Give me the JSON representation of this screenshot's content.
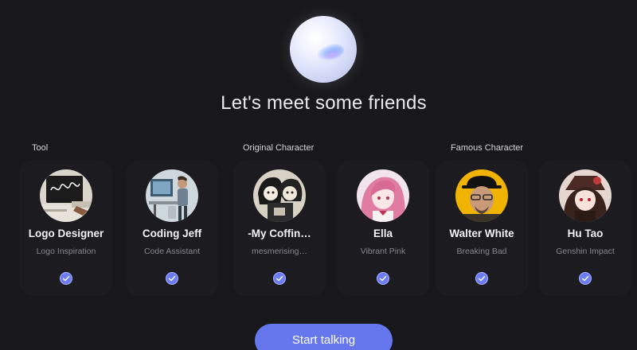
{
  "title": "Let's meet some friends",
  "groups": [
    {
      "label": "Tool"
    },
    {
      "label": "Original Character"
    },
    {
      "label": "Famous Character"
    }
  ],
  "characters": [
    {
      "name": "Logo Designer",
      "subtitle": "Logo Inspiration",
      "selected": true
    },
    {
      "name": "Coding Jeff",
      "subtitle": "Code Assistant",
      "selected": true
    },
    {
      "name": "-My Coffin…",
      "subtitle": "mesmerising…",
      "selected": true
    },
    {
      "name": "Ella",
      "subtitle": "Vibrant Pink",
      "selected": true
    },
    {
      "name": "Walter White",
      "subtitle": "Breaking Bad",
      "selected": true
    },
    {
      "name": "Hu Tao",
      "subtitle": "Genshin Impact",
      "selected": true
    }
  ],
  "start_button": {
    "label": "Start talking"
  },
  "colors": {
    "background": "#18181b",
    "accent": "#6677ee",
    "check": "#6b7cf6",
    "text": "#f2f2f5",
    "subtext": "#85858f"
  }
}
